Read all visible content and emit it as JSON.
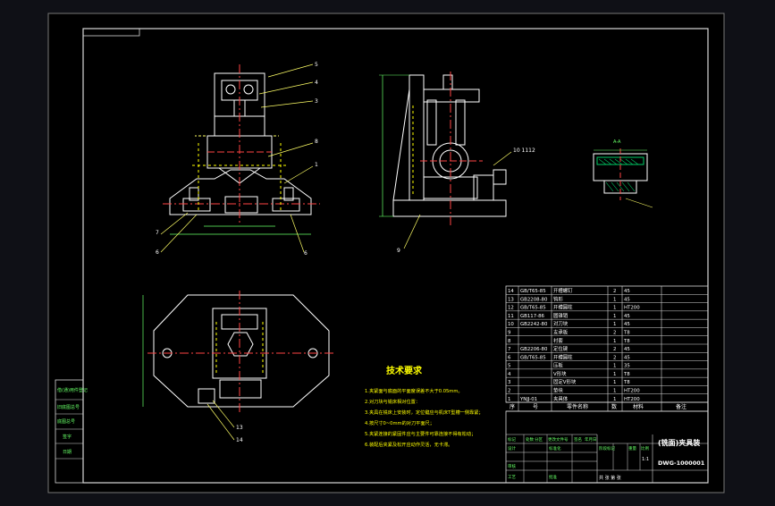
{
  "colors": {
    "background": "#0f1016",
    "sheet": "#000000",
    "frame": "#d8d8d8",
    "part_lines": "#ffffff",
    "leaders": "#ffff66",
    "dimensions": "#66ff66",
    "centerlines": "#ff4444",
    "hidden_lines": "#ffff00",
    "table_text": "#ffffff",
    "notes_text": "#ffff00",
    "section_hatch": "#00cc66"
  },
  "balloons": {
    "front_view": [
      "5",
      "4",
      "3",
      "8",
      "1",
      "7",
      "6",
      "6"
    ],
    "side_view": [
      "10 1112",
      "9"
    ],
    "top_view": [
      "13",
      "14"
    ]
  },
  "technical_requirements": {
    "title": "技术要求",
    "items": [
      "1.夹紧面与底面的平面度误差不大于0.05mm。",
      "2.对刀块与铣床相对位置：",
      "3.夹具在铣床上安装时，定位键应与机床T型槽一侧靠紧；",
      "4.按尺寸0~0mm的对刀平面尺；",
      "5.夹紧连接的紧固件应与主要件可靠连接不得有松动；",
      "6.装配后夹紧及松开应动作灵活，无卡滞。"
    ]
  },
  "parts_list": {
    "rows": [
      [
        "14",
        "GB/T65-85",
        "开槽螺钉",
        "2",
        "45",
        ""
      ],
      [
        "13",
        "GB2208-80",
        "钩形",
        "1",
        "45",
        ""
      ],
      [
        "12",
        "GB/T65-85",
        "开槽圆柱",
        "1",
        "HT200",
        ""
      ],
      [
        "11",
        "GB117-86",
        "圆锥销",
        "1",
        "45",
        ""
      ],
      [
        "10",
        "GB2242-80",
        "对刀块",
        "1",
        "45",
        ""
      ],
      [
        "9",
        "",
        "支承板",
        "2",
        "T8",
        ""
      ],
      [
        "8",
        "",
        "衬套",
        "1",
        "T8",
        ""
      ],
      [
        "7",
        "GB2206-80",
        "定位键",
        "2",
        "45",
        ""
      ],
      [
        "6",
        "GB/T65-85",
        "开槽圆柱",
        "2",
        "45",
        ""
      ],
      [
        "5",
        "",
        "压板",
        "1",
        "35",
        ""
      ],
      [
        "4",
        "",
        "V形块",
        "1",
        "T8",
        ""
      ],
      [
        "3",
        "",
        "固定V形块",
        "1",
        "T8",
        ""
      ],
      [
        "2",
        "",
        "垫块",
        "1",
        "HT200",
        ""
      ],
      [
        "1",
        "YNJJ-01",
        "夹具体",
        "1",
        "HT200",
        ""
      ]
    ],
    "header": [
      "序",
      "号",
      "零件名称",
      "数",
      "材料",
      "备注"
    ]
  },
  "title_block": {
    "drawing_title": "(铣面)夹具装",
    "drawing_number": "DWG-1000001",
    "scale": "1:1",
    "sheet": "共 张 第 张",
    "labels": [
      "标记",
      "处数",
      "分区",
      "更改文件号",
      "签名",
      "年月日",
      "设计",
      "审核",
      "工艺",
      "批准",
      "标准化",
      "阶段标记",
      "重量",
      "比例"
    ]
  },
  "revision_column": {
    "labels": [
      "借(通)用件登记",
      "旧底图总号",
      "底图总号",
      "签字",
      "日期"
    ]
  },
  "section_view": {
    "label": "A-A"
  },
  "corner_stamp": {
    "text": "借(通)用件登记"
  }
}
